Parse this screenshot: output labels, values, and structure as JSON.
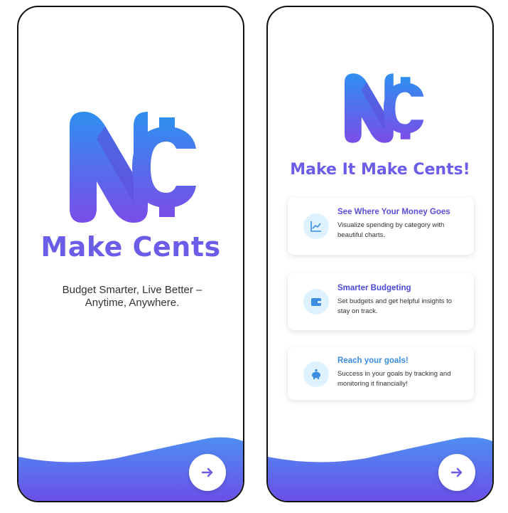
{
  "splash": {
    "title": "Make Cents",
    "tagline_line1": "Budget Smarter, Live Better –",
    "tagline_line2": "Anytime, Anywhere."
  },
  "onboarding": {
    "title": "Make It Make Cents!",
    "features": [
      {
        "title": "See Where Your Money Goes",
        "text": "Visualize spending by category with beautiful charts.",
        "icon": "chart-icon"
      },
      {
        "title": "Smarter Budgeting",
        "text": "Set budgets and get helpful insights to stay on track.",
        "icon": "wallet-icon"
      },
      {
        "title": "Reach your goals!",
        "text": "Success in your goals by tracking and monitoring it financially!",
        "icon": "piggy-bank-icon"
      }
    ]
  },
  "colors": {
    "brand_purple": "#6b5de8",
    "brand_blue": "#2f8ff0",
    "icon_bg": "#def1ff"
  }
}
